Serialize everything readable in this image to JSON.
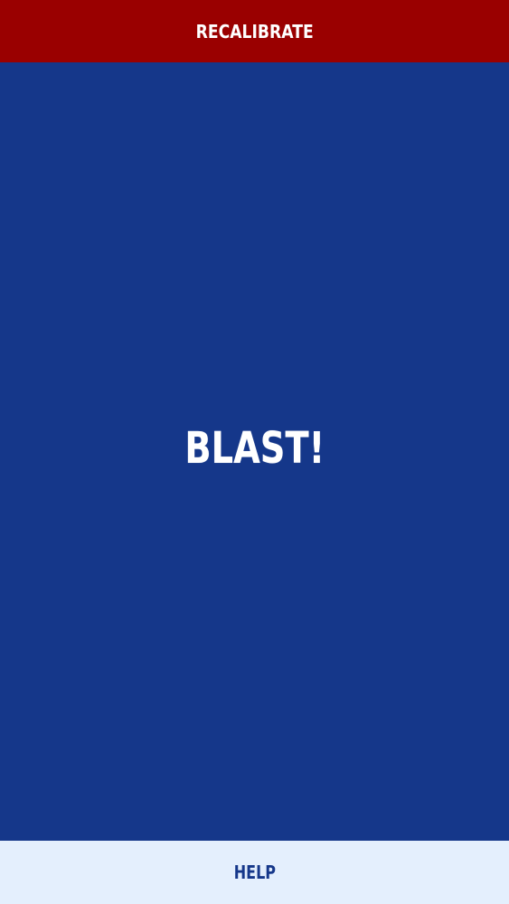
{
  "header": {
    "recalibrate_label": "RECALIBRATE"
  },
  "main": {
    "blast_label": "BLAST!"
  },
  "footer": {
    "help_label": "HELP"
  },
  "colors": {
    "header_background": "#9a0000",
    "main_background": "#15378a",
    "footer_background": "#e4effd",
    "label_light": "#ffffff",
    "label_dark": "#15378a"
  }
}
